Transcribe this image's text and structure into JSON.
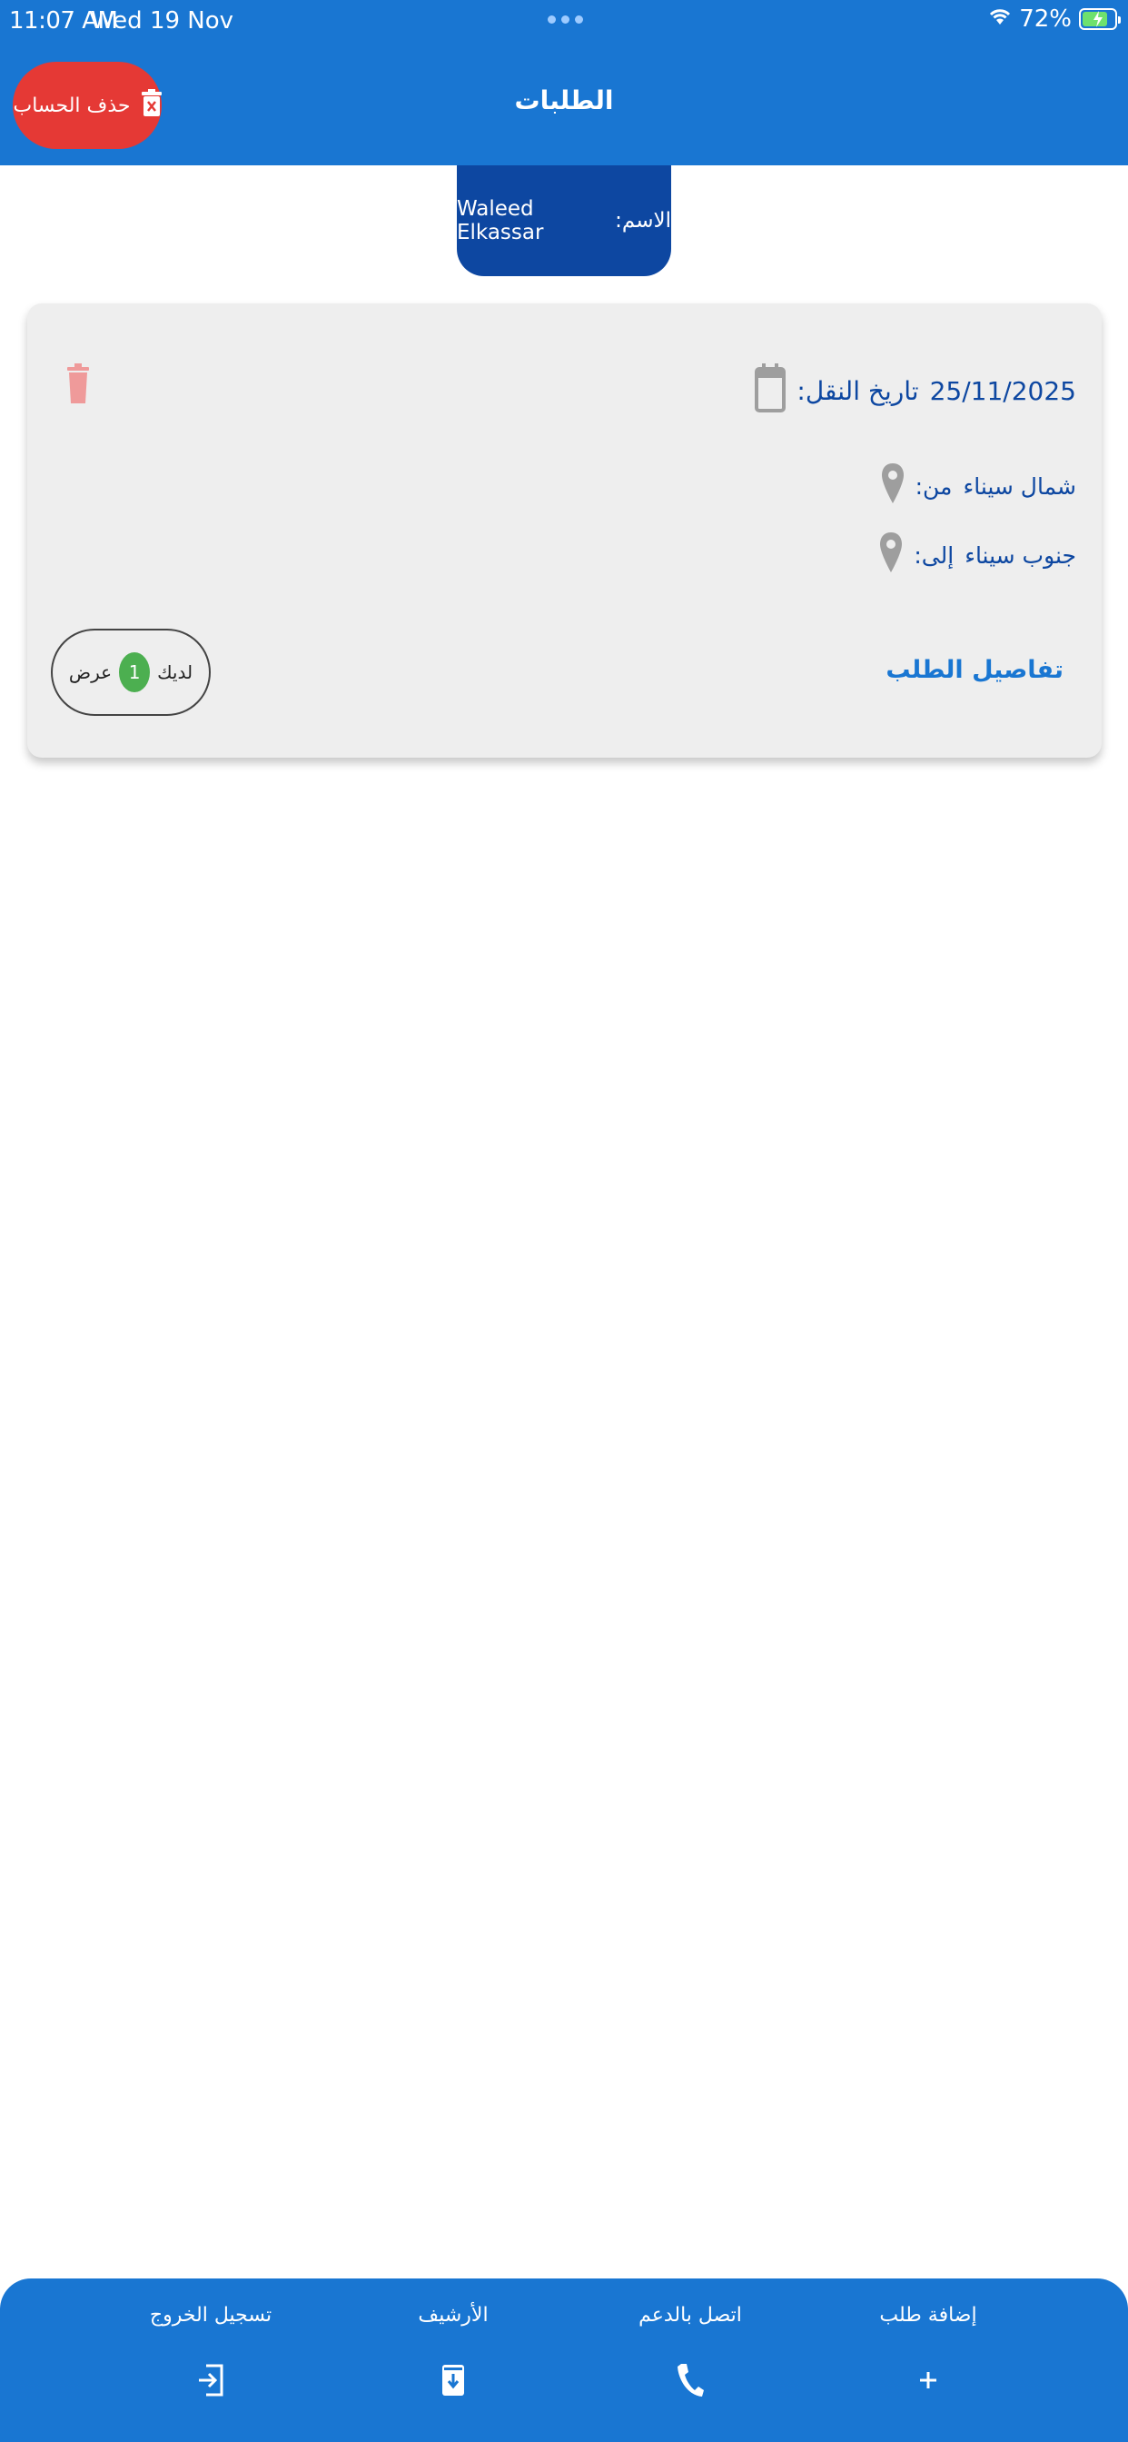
{
  "status_bar": {
    "time": "11:07 AM",
    "date": "Wed 19 Nov",
    "battery": "72%"
  },
  "header": {
    "title": "الطلبات",
    "delete_account_label": "حذف الحساب"
  },
  "user": {
    "name_label": "الاسم:",
    "name": "Waleed Elkassar"
  },
  "request": {
    "date_label": "تاريخ النقل:",
    "date": "25/11/2025",
    "from_label": "من:",
    "from": "شمال سيناء",
    "to_label": "إلى:",
    "to": "جنوب سيناء",
    "details_link": "تفاصيل الطلب",
    "offers_prefix": "لديك",
    "offers_count": "1",
    "offers_suffix": "عرض"
  },
  "bottom_nav": {
    "add_request": "إضافة طلب",
    "contact_support": "اتصل بالدعم",
    "archive": "الأرشيف",
    "logout": "تسجيل الخروج"
  },
  "colors": {
    "primary": "#1976D2",
    "dark_blue": "#0D47A1",
    "danger": "#E53935",
    "success": "#4CAF50"
  }
}
